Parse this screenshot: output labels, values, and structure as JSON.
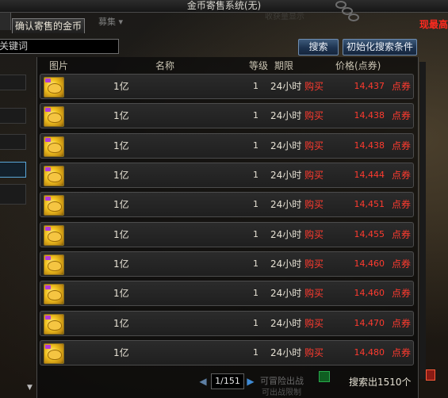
{
  "window": {
    "title": "金币寄售系统(无)"
  },
  "corner_notice": "现最高",
  "tab": {
    "label": "确认寄售的金币"
  },
  "faint_labels": {
    "dropdown": "募集 ▾",
    "top_small": "收获量显示",
    "bottom_line1": "可冒险出战",
    "bottom_line2": "可出战限制"
  },
  "search": {
    "input_value": "关键词",
    "search_button": "搜索",
    "reset_button": "初始化搜索条件"
  },
  "table": {
    "columns": {
      "image": "图片",
      "name": "名称",
      "level": "等级",
      "period": "期限",
      "price": "价格(点券)"
    },
    "rows": [
      {
        "name": "1亿",
        "level": "1",
        "period": "24小时",
        "action": "购买",
        "price": "14,437",
        "unit": "点券"
      },
      {
        "name": "1亿",
        "level": "1",
        "period": "24小时",
        "action": "购买",
        "price": "14,438",
        "unit": "点券"
      },
      {
        "name": "1亿",
        "level": "1",
        "period": "24小时",
        "action": "购买",
        "price": "14,438",
        "unit": "点券"
      },
      {
        "name": "1亿",
        "level": "1",
        "period": "24小时",
        "action": "购买",
        "price": "14,444",
        "unit": "点券"
      },
      {
        "name": "1亿",
        "level": "1",
        "period": "24小时",
        "action": "购买",
        "price": "14,451",
        "unit": "点券"
      },
      {
        "name": "1亿",
        "level": "1",
        "period": "24小时",
        "action": "购买",
        "price": "14,455",
        "unit": "点券"
      },
      {
        "name": "1亿",
        "level": "1",
        "period": "24小时",
        "action": "购买",
        "price": "14,460",
        "unit": "点券"
      },
      {
        "name": "1亿",
        "level": "1",
        "period": "24小时",
        "action": "购买",
        "price": "14,460",
        "unit": "点券"
      },
      {
        "name": "1亿",
        "level": "1",
        "period": "24小时",
        "action": "购买",
        "price": "14,470",
        "unit": "点券"
      },
      {
        "name": "1亿",
        "level": "1",
        "period": "24小时",
        "action": "购买",
        "price": "14,480",
        "unit": "点券"
      }
    ]
  },
  "pager": {
    "page_display": "1/151",
    "prev_icon": "triangle-left-icon",
    "next_icon": "triangle-right-icon"
  },
  "result_count": "搜索出1510个",
  "colors": {
    "price_red": "#ff3b2f",
    "button_blue": "#1d3350",
    "selected_border": "#5aa7d8"
  }
}
